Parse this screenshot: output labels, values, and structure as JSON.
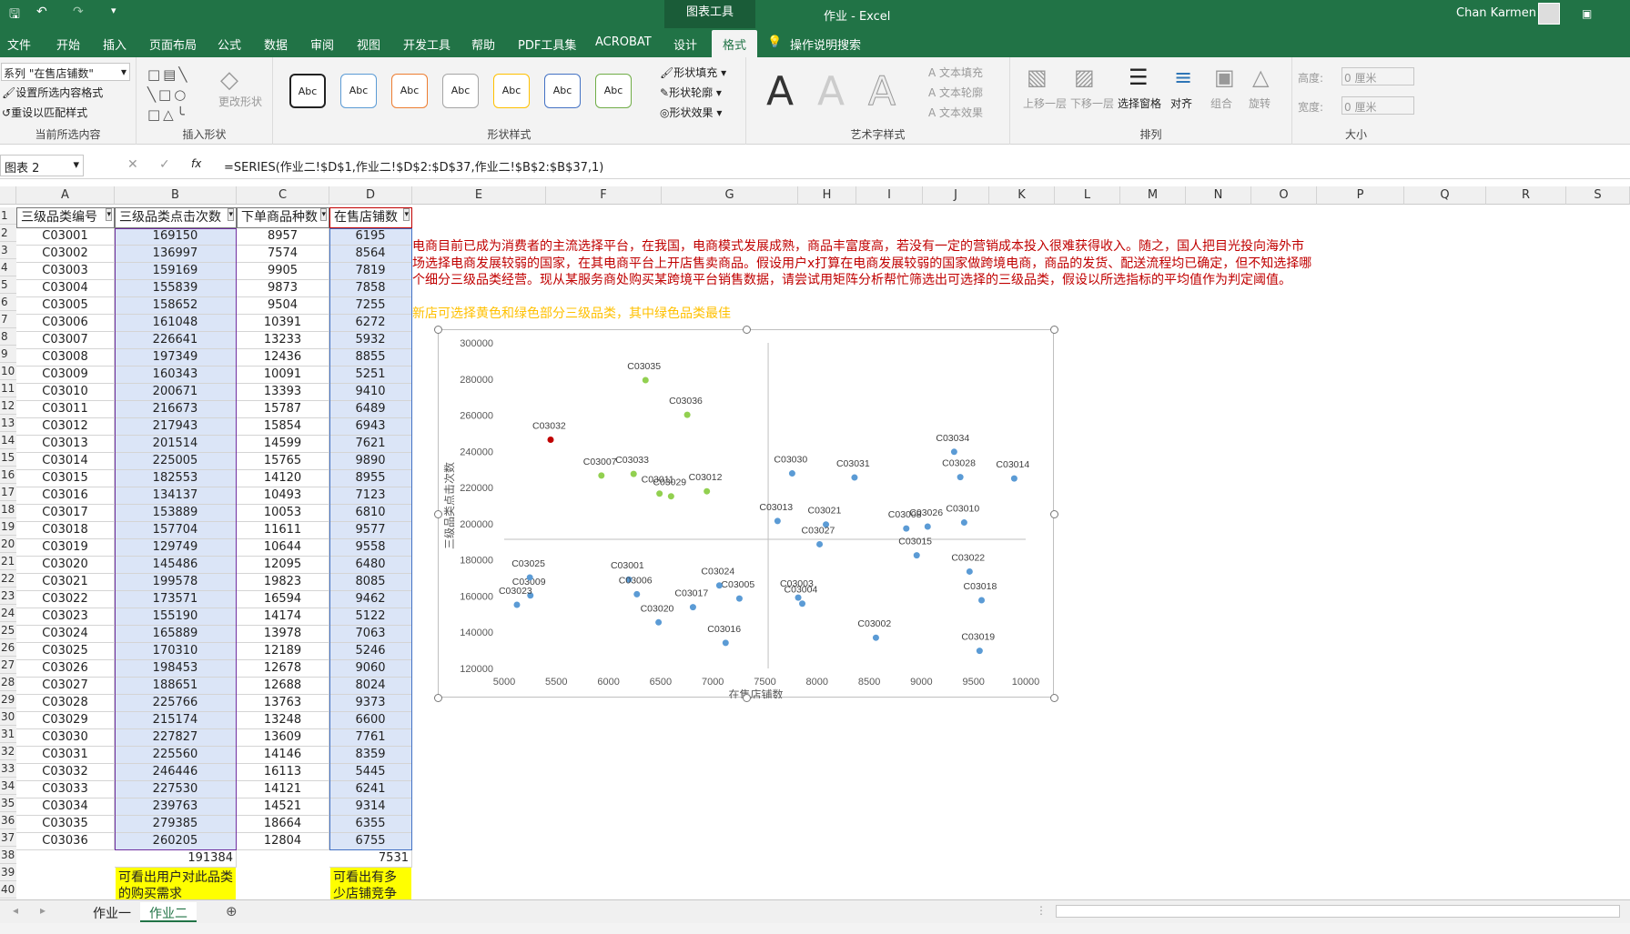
{
  "titlebar": {
    "tools": "图表工具",
    "doc": "作业  -  Excel",
    "user": "Chan Karmen"
  },
  "tabs": [
    "文件",
    "开始",
    "插入",
    "页面布局",
    "公式",
    "数据",
    "审阅",
    "视图",
    "开发工具",
    "帮助",
    "PDF工具集",
    "ACROBAT",
    "设计",
    "格式"
  ],
  "tell_me": "操作说明搜索",
  "ribbon": {
    "current_sel": {
      "series": "系列 \"在售店铺数\"",
      "format": "设置所选内容格式",
      "reset": "重设以匹配样式",
      "label": "当前所选内容"
    },
    "insert_shapes": {
      "change": "更改形状",
      "label": "插入形状"
    },
    "shape_styles": {
      "abc": "Abc",
      "fill": "形状填充",
      "outline": "形状轮廓",
      "effect": "形状效果",
      "label": "形状样式"
    },
    "wordart": {
      "a": "A",
      "tfill": "文本填充",
      "toutline": "文本轮廓",
      "teffect": "文本效果",
      "label": "艺术字样式"
    },
    "arrange": {
      "up": "上移一层",
      "down": "下移一层",
      "pane": "选择窗格",
      "align": "对齐",
      "group": "组合",
      "rotate": "旋转",
      "label": "排列"
    },
    "size": {
      "h": "高度:",
      "w": "宽度:",
      "hval": "0 厘米",
      "wval": "0 厘米",
      "label": "大小"
    }
  },
  "formula_bar": {
    "name": "图表 2",
    "fx": "fx",
    "formula": "=SERIES(作业二!$D$1,作业二!$D$2:$D$37,作业二!$B$2:$B$37,1)"
  },
  "columns": [
    "A",
    "B",
    "C",
    "D",
    "E",
    "F",
    "G",
    "H",
    "I",
    "J",
    "K",
    "L",
    "M",
    "N",
    "O",
    "P",
    "Q",
    "R",
    "S"
  ],
  "headers": [
    "三级品类编号",
    "三级品类点击次数",
    "下单商品种数",
    "在售店铺数"
  ],
  "rows": [
    [
      "C03001",
      "169150",
      "8957",
      "6195"
    ],
    [
      "C03002",
      "136997",
      "7574",
      "8564"
    ],
    [
      "C03003",
      "159169",
      "9905",
      "7819"
    ],
    [
      "C03004",
      "155839",
      "9873",
      "7858"
    ],
    [
      "C03005",
      "158652",
      "9504",
      "7255"
    ],
    [
      "C03006",
      "161048",
      "10391",
      "6272"
    ],
    [
      "C03007",
      "226641",
      "13233",
      "5932"
    ],
    [
      "C03008",
      "197349",
      "12436",
      "8855"
    ],
    [
      "C03009",
      "160343",
      "10091",
      "5251"
    ],
    [
      "C03010",
      "200671",
      "13393",
      "9410"
    ],
    [
      "C03011",
      "216673",
      "15787",
      "6489"
    ],
    [
      "C03012",
      "217943",
      "15854",
      "6943"
    ],
    [
      "C03013",
      "201514",
      "14599",
      "7621"
    ],
    [
      "C03014",
      "225005",
      "15765",
      "9890"
    ],
    [
      "C03015",
      "182553",
      "14120",
      "8955"
    ],
    [
      "C03016",
      "134137",
      "10493",
      "7123"
    ],
    [
      "C03017",
      "153889",
      "10053",
      "6810"
    ],
    [
      "C03018",
      "157704",
      "11611",
      "9577"
    ],
    [
      "C03019",
      "129749",
      "10644",
      "9558"
    ],
    [
      "C03020",
      "145486",
      "12095",
      "6480"
    ],
    [
      "C03021",
      "199578",
      "19823",
      "8085"
    ],
    [
      "C03022",
      "173571",
      "16594",
      "9462"
    ],
    [
      "C03023",
      "155190",
      "14174",
      "5122"
    ],
    [
      "C03024",
      "165889",
      "13978",
      "7063"
    ],
    [
      "C03025",
      "170310",
      "12189",
      "5246"
    ],
    [
      "C03026",
      "198453",
      "12678",
      "9060"
    ],
    [
      "C03027",
      "188651",
      "12688",
      "8024"
    ],
    [
      "C03028",
      "225766",
      "13763",
      "9373"
    ],
    [
      "C03029",
      "215174",
      "13248",
      "6600"
    ],
    [
      "C03030",
      "227827",
      "13609",
      "7761"
    ],
    [
      "C03031",
      "225560",
      "14146",
      "8359"
    ],
    [
      "C03032",
      "246446",
      "16113",
      "5445"
    ],
    [
      "C03033",
      "227530",
      "14121",
      "6241"
    ],
    [
      "C03034",
      "239763",
      "14521",
      "9314"
    ],
    [
      "C03035",
      "279385",
      "18664",
      "6355"
    ],
    [
      "C03036",
      "260205",
      "12804",
      "6755"
    ]
  ],
  "totals": {
    "b": "191384",
    "d": "7531"
  },
  "yellow_notes": {
    "b": "可看出用户对此品类的购买需求",
    "d": "可看出有多少店铺竞争"
  },
  "note_red": "电商目前已成为消费者的主流选择平台，在我国，电商模式发展成熟，商品丰富度高，若没有一定的营销成本投入很难获得收入。随之，国人把目光投向海外市场选择电商发展较弱的国家，在其电商平台上开店售卖商品。假设用户x打算在电商发展较弱的国家做跨境电商，商品的发货、配送流程均已确定，但不知选择哪个细分三级品类经营。现从某服务商处购买某跨境平台销售数据，请尝试用矩阵分析帮忙筛选出可选择的三级品类，假设以所选指标的平均值作为判定阈值。",
  "note_yellow": "新店可选择黄色和绿色部分三级品类，其中绿色品类最佳",
  "chart_data": {
    "type": "scatter",
    "xlabel": "在售店铺数",
    "ylabel": "三级品类点击次数",
    "xlim": [
      5000,
      10000
    ],
    "ylim": [
      120000,
      300000
    ],
    "xticks": [
      5000,
      5500,
      6000,
      6500,
      7000,
      7500,
      8000,
      8500,
      9000,
      9500,
      10000
    ],
    "yticks": [
      120000,
      140000,
      160000,
      180000,
      200000,
      220000,
      240000,
      260000,
      280000,
      300000
    ],
    "threshold": {
      "x": 7531,
      "y": 191384
    },
    "colors": {
      "default": "#5b9bd5",
      "green": "#92d050",
      "red": "#c00000"
    },
    "points": [
      {
        "label": "C03001",
        "x": 6195,
        "y": 169150
      },
      {
        "label": "C03002",
        "x": 8564,
        "y": 136997
      },
      {
        "label": "C03003",
        "x": 7819,
        "y": 159169
      },
      {
        "label": "C03004",
        "x": 7858,
        "y": 155839
      },
      {
        "label": "C03005",
        "x": 7255,
        "y": 158652
      },
      {
        "label": "C03006",
        "x": 6272,
        "y": 161048
      },
      {
        "label": "C03007",
        "x": 5932,
        "y": 226641,
        "c": "green"
      },
      {
        "label": "C03008",
        "x": 8855,
        "y": 197349
      },
      {
        "label": "C03009",
        "x": 5251,
        "y": 160343
      },
      {
        "label": "C03010",
        "x": 9410,
        "y": 200671
      },
      {
        "label": "C03011",
        "x": 6489,
        "y": 216673,
        "c": "green"
      },
      {
        "label": "C03012",
        "x": 6943,
        "y": 217943,
        "c": "green"
      },
      {
        "label": "C03013",
        "x": 7621,
        "y": 201514
      },
      {
        "label": "C03014",
        "x": 9890,
        "y": 225005
      },
      {
        "label": "C03015",
        "x": 8955,
        "y": 182553
      },
      {
        "label": "C03016",
        "x": 7123,
        "y": 134137
      },
      {
        "label": "C03017",
        "x": 6810,
        "y": 153889
      },
      {
        "label": "C03018",
        "x": 9577,
        "y": 157704
      },
      {
        "label": "C03019",
        "x": 9558,
        "y": 129749
      },
      {
        "label": "C03020",
        "x": 6480,
        "y": 145486
      },
      {
        "label": "C03021",
        "x": 8085,
        "y": 199578
      },
      {
        "label": "C03022",
        "x": 9462,
        "y": 173571
      },
      {
        "label": "C03023",
        "x": 5122,
        "y": 155190
      },
      {
        "label": "C03024",
        "x": 7063,
        "y": 165889
      },
      {
        "label": "C03025",
        "x": 5246,
        "y": 170310
      },
      {
        "label": "C03026",
        "x": 9060,
        "y": 198453
      },
      {
        "label": "C03027",
        "x": 8024,
        "y": 188651
      },
      {
        "label": "C03028",
        "x": 9373,
        "y": 225766
      },
      {
        "label": "C03029",
        "x": 6600,
        "y": 215174,
        "c": "green"
      },
      {
        "label": "C03030",
        "x": 7761,
        "y": 227827
      },
      {
        "label": "C03031",
        "x": 8359,
        "y": 225560
      },
      {
        "label": "C03032",
        "x": 5445,
        "y": 246446,
        "c": "red"
      },
      {
        "label": "C03033",
        "x": 6241,
        "y": 227530,
        "c": "green"
      },
      {
        "label": "C03034",
        "x": 9314,
        "y": 239763
      },
      {
        "label": "C03035",
        "x": 6355,
        "y": 279385,
        "c": "green"
      },
      {
        "label": "C03036",
        "x": 6755,
        "y": 260205,
        "c": "green"
      }
    ]
  },
  "sheets": [
    "作业一",
    "作业二"
  ]
}
